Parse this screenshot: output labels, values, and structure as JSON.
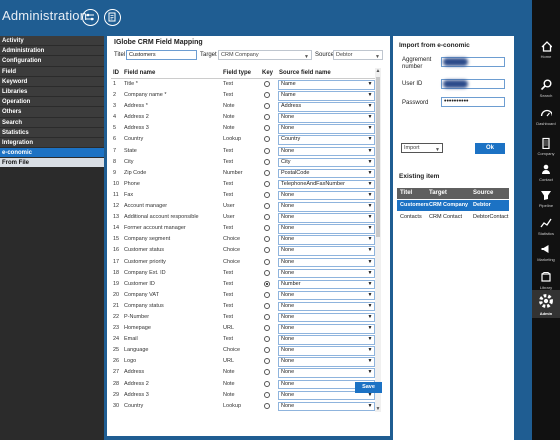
{
  "app": {
    "title": "Administration"
  },
  "toolbar": {
    "icons": [
      "settings-sliders-icon",
      "document-icon"
    ]
  },
  "nav": {
    "items": [
      {
        "label": "Activity",
        "state": "normal"
      },
      {
        "label": "Administration",
        "state": "normal"
      },
      {
        "label": "Configuration",
        "state": "normal"
      },
      {
        "label": "Field",
        "state": "normal"
      },
      {
        "label": "Keyword",
        "state": "normal"
      },
      {
        "label": "Libraries",
        "state": "normal"
      },
      {
        "label": "Operation",
        "state": "normal"
      },
      {
        "label": "Others",
        "state": "normal"
      },
      {
        "label": "Search",
        "state": "normal"
      },
      {
        "label": "Statistics",
        "state": "normal"
      },
      {
        "label": "Integration",
        "state": "normal"
      },
      {
        "label": "e-conomic",
        "state": "selected"
      },
      {
        "label": "From File",
        "state": "sub"
      }
    ]
  },
  "mapping": {
    "title": "IGlobe CRM Field Mapping",
    "titel_label": "Titel",
    "titel_value": "Customers",
    "target_label": "Target",
    "target_value": "CRM Company",
    "source_label": "Source",
    "source_value": "Debtor",
    "headers": {
      "id": "ID",
      "field": "Field name",
      "type": "Field type",
      "key": "Key",
      "source": "Source field name"
    },
    "rows": [
      {
        "id": "1",
        "field": "Title *",
        "type": "Text",
        "key": false,
        "source": "Name"
      },
      {
        "id": "2",
        "field": "Company name *",
        "type": "Text",
        "key": false,
        "source": "Name"
      },
      {
        "id": "3",
        "field": "Address *",
        "type": "Note",
        "key": false,
        "source": "Address"
      },
      {
        "id": "4",
        "field": "Address 2",
        "type": "Note",
        "key": false,
        "source": "None"
      },
      {
        "id": "5",
        "field": "Address 3",
        "type": "Note",
        "key": false,
        "source": "None"
      },
      {
        "id": "6",
        "field": "Country",
        "type": "Lookup",
        "key": false,
        "source": "Country"
      },
      {
        "id": "7",
        "field": "State",
        "type": "Text",
        "key": false,
        "source": "None"
      },
      {
        "id": "8",
        "field": "City",
        "type": "Text",
        "key": false,
        "source": "City"
      },
      {
        "id": "9",
        "field": "Zip Code",
        "type": "Number",
        "key": false,
        "source": "PostalCode"
      },
      {
        "id": "10",
        "field": "Phone",
        "type": "Text",
        "key": false,
        "source": "TelephoneAndFaxNumber"
      },
      {
        "id": "11",
        "field": "Fax",
        "type": "Text",
        "key": false,
        "source": "None"
      },
      {
        "id": "12",
        "field": "Account manager",
        "type": "User",
        "key": false,
        "source": "None"
      },
      {
        "id": "13",
        "field": "Additional account responsible",
        "type": "User",
        "key": false,
        "source": "None"
      },
      {
        "id": "14",
        "field": "Former account manager",
        "type": "Text",
        "key": false,
        "source": "None"
      },
      {
        "id": "15",
        "field": "Company segment",
        "type": "Choice",
        "key": false,
        "source": "None"
      },
      {
        "id": "16",
        "field": "Customer status",
        "type": "Choice",
        "key": false,
        "source": "None"
      },
      {
        "id": "17",
        "field": "Customer priority",
        "type": "Choice",
        "key": false,
        "source": "None"
      },
      {
        "id": "18",
        "field": "Company Ext. ID",
        "type": "Text",
        "key": false,
        "source": "None"
      },
      {
        "id": "19",
        "field": "Customer ID",
        "type": "Text",
        "key": true,
        "source": "Number"
      },
      {
        "id": "20",
        "field": "Company VAT",
        "type": "Text",
        "key": false,
        "source": "None"
      },
      {
        "id": "21",
        "field": "Company status",
        "type": "Text",
        "key": false,
        "source": "None"
      },
      {
        "id": "22",
        "field": "P-Number",
        "type": "Text",
        "key": false,
        "source": "None"
      },
      {
        "id": "23",
        "field": "Homepage",
        "type": "URL",
        "key": false,
        "source": "None"
      },
      {
        "id": "24",
        "field": "Email",
        "type": "Text",
        "key": false,
        "source": "None"
      },
      {
        "id": "25",
        "field": "Language",
        "type": "Choice",
        "key": false,
        "source": "None"
      },
      {
        "id": "26",
        "field": "Logo",
        "type": "URL",
        "key": false,
        "source": "None"
      },
      {
        "id": "27",
        "field": "Address",
        "type": "Note",
        "key": false,
        "source": "None"
      },
      {
        "id": "28",
        "field": "Address 2",
        "type": "Note",
        "key": false,
        "source": "None"
      },
      {
        "id": "29",
        "field": "Address 3",
        "type": "Note",
        "key": false,
        "source": "None"
      },
      {
        "id": "30",
        "field": "Country",
        "type": "Lookup",
        "key": false,
        "source": "None"
      }
    ],
    "save_label": "Save"
  },
  "import": {
    "title": "Import from e-conomic",
    "agreement_label": "Aggrement number",
    "userid_label": "User ID",
    "password_label": "Password",
    "password_value": "••••••••••",
    "action_value": "Import",
    "ok_label": "Ok"
  },
  "existing": {
    "title": "Existing item",
    "headers": {
      "titel": "Titel",
      "target": "Target",
      "source": "Source"
    },
    "rows": [
      {
        "titel": "Customers",
        "target": "CRM Company",
        "source": "Debtor",
        "selected": true
      },
      {
        "titel": "Contacts",
        "target": "CRM Contact",
        "source": "DebtorContact",
        "selected": false
      }
    ]
  },
  "rightbar": {
    "items": [
      {
        "label": "Home",
        "icon": "home-icon"
      },
      {
        "label": "Search",
        "icon": "search-icon"
      },
      {
        "label": "Dashboard",
        "icon": "dashboard-icon"
      },
      {
        "label": "Company",
        "icon": "company-icon"
      },
      {
        "label": "Contact",
        "icon": "contact-icon"
      },
      {
        "label": "Pipeline",
        "icon": "pipeline-icon"
      },
      {
        "label": "Statistics",
        "icon": "statistics-icon"
      },
      {
        "label": "Marketing",
        "icon": "marketing-icon"
      },
      {
        "label": "Library",
        "icon": "library-icon"
      },
      {
        "label": "Admin",
        "icon": "admin-gear-icon"
      }
    ]
  },
  "colors": {
    "accent": "#1c72c4",
    "titlebar": "#1f5d92",
    "nav_bg": "#3c3c3c",
    "rightbar": "#111111"
  }
}
